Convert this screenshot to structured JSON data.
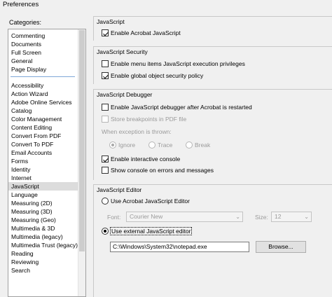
{
  "window": {
    "title": "Preferences"
  },
  "categories": {
    "label": "Categories:",
    "top_items": [
      "Commenting",
      "Documents",
      "Full Screen",
      "General",
      "Page Display"
    ],
    "items": [
      "Accessibility",
      "Action Wizard",
      "Adobe Online Services",
      "Catalog",
      "Color Management",
      "Content Editing",
      "Convert From PDF",
      "Convert To PDF",
      "Email Accounts",
      "Forms",
      "Identity",
      "Internet",
      "JavaScript",
      "Language",
      "Measuring (2D)",
      "Measuring (3D)",
      "Measuring (Geo)",
      "Multimedia & 3D",
      "Multimedia (legacy)",
      "Multimedia Trust (legacy)",
      "Reading",
      "Reviewing",
      "Search"
    ],
    "selected": "JavaScript"
  },
  "javascript": {
    "title": "JavaScript",
    "enable_acrobat_js": {
      "label": "Enable Acrobat JavaScript",
      "checked": true
    }
  },
  "security": {
    "title": "JavaScript Security",
    "enable_menu_privileges": {
      "label": "Enable menu items JavaScript execution privileges",
      "checked": false
    },
    "enable_global_policy": {
      "label": "Enable global object security policy",
      "checked": true
    }
  },
  "debugger": {
    "title": "JavaScript Debugger",
    "enable_debugger": {
      "label": "Enable JavaScript debugger after Acrobat is restarted",
      "checked": false
    },
    "store_breakpoints": {
      "label": "Store breakpoints in PDF file",
      "checked": false
    },
    "exception_label": "When exception is thrown:",
    "exception_options": [
      "Ignore",
      "Trace",
      "Break"
    ],
    "exception_selected": "Ignore",
    "enable_console": {
      "label": "Enable interactive console",
      "checked": true
    },
    "show_console": {
      "label": "Show console on errors and messages",
      "checked": false
    }
  },
  "editor": {
    "title": "JavaScript Editor",
    "use_acrobat_editor": {
      "label": "Use Acrobat JavaScript Editor",
      "selected": false
    },
    "font_label": "Font:",
    "font_value": "Courier New",
    "size_label": "Size:",
    "size_value": "12",
    "use_external_editor": {
      "label": "Use external JavaScript editor",
      "selected": true
    },
    "editor_path": "C:\\Windows\\System32\\notepad.exe",
    "browse_label": "Browse..."
  },
  "icons": {
    "checkmark": "check-icon",
    "dropdown": "chevron-down-icon"
  }
}
